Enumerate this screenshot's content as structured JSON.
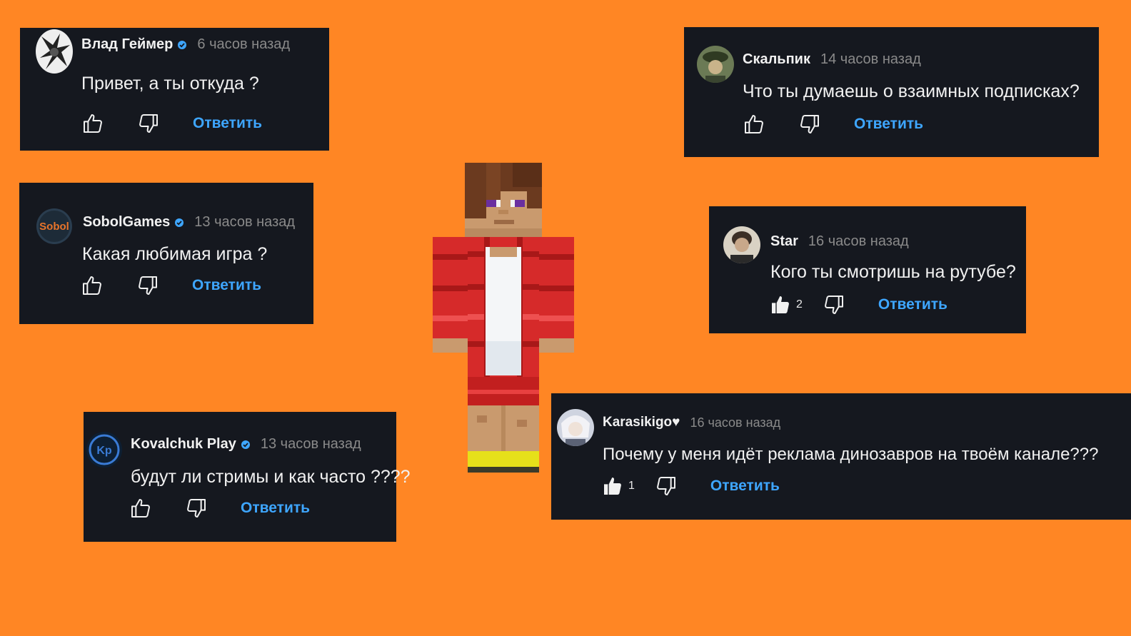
{
  "reply_label": "Ответить",
  "colors": {
    "background": "#ff8624",
    "card": "#15181f",
    "reply": "#3ea6ff",
    "timestamp": "#8a8a8a",
    "verified": "#3ea6ff"
  },
  "comments": [
    {
      "author": "Влад Геймер",
      "verified": true,
      "time": "6 часов назад",
      "text": "Привет, а ты откуда ?",
      "likes": "",
      "liked": false
    },
    {
      "author": "Скальпик",
      "verified": false,
      "time": "14 часов назад",
      "text": "Что ты думаешь о взаимных подписках?",
      "likes": "",
      "liked": false
    },
    {
      "author": "SobolGames",
      "verified": true,
      "time": "13 часов назад",
      "text": "Какая любимая игра ?",
      "likes": "",
      "liked": false
    },
    {
      "author": "Star",
      "verified": false,
      "time": "16 часов назад",
      "text": "Кого ты смотришь на рутубе?",
      "likes": "2",
      "liked": true
    },
    {
      "author": "Kovalchuk Play",
      "verified": true,
      "time": "13 часов назад",
      "text": "будут ли стримы и как часто ????",
      "likes": "",
      "liked": false
    },
    {
      "author": "Karasikigo♥",
      "verified": false,
      "time": "16 часов назад",
      "text": "Почему у меня идёт реклама динозавров на твоём канале???",
      "likes": "1",
      "liked": true
    }
  ],
  "icons": {
    "like": "thumbs-up-icon",
    "dislike": "thumbs-down-icon",
    "verified": "verified-badge-icon"
  }
}
